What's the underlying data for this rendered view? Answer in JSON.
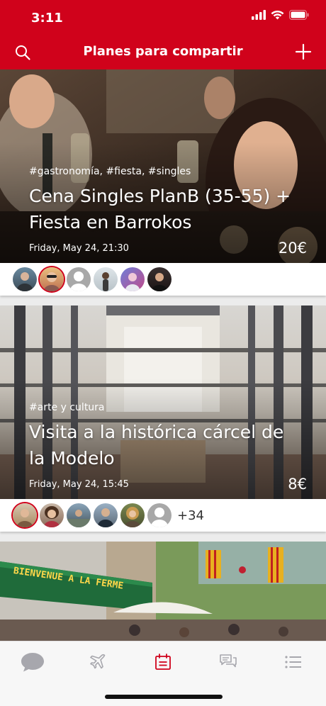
{
  "status_bar": {
    "time": "3:11"
  },
  "header": {
    "title": "Planes para compartir"
  },
  "cards": [
    {
      "tags": "#gastronomía, #fiesta, #singles",
      "title": "Cena Singles PlanB (35-55) + Fiesta en Barrokos",
      "date": "Friday, May 24, 21:30",
      "price": "20€"
    },
    {
      "tags": "#arte y cultura",
      "title": "Visita a la histórica cárcel de la Modelo",
      "date": "Friday, May 24, 15:45",
      "price": "8€",
      "more_attendees": "+34"
    },
    {
      "sign_text": "BIENVENUE A LA FERME"
    }
  ],
  "tabs": [
    {
      "icon": "chat-bubble-icon"
    },
    {
      "icon": "airplane-icon"
    },
    {
      "icon": "calendar-icon",
      "active": true
    },
    {
      "icon": "messages-icon"
    },
    {
      "icon": "list-icon"
    }
  ],
  "colors": {
    "brand": "#d0021b",
    "tab_inactive": "#a7a7ad"
  }
}
